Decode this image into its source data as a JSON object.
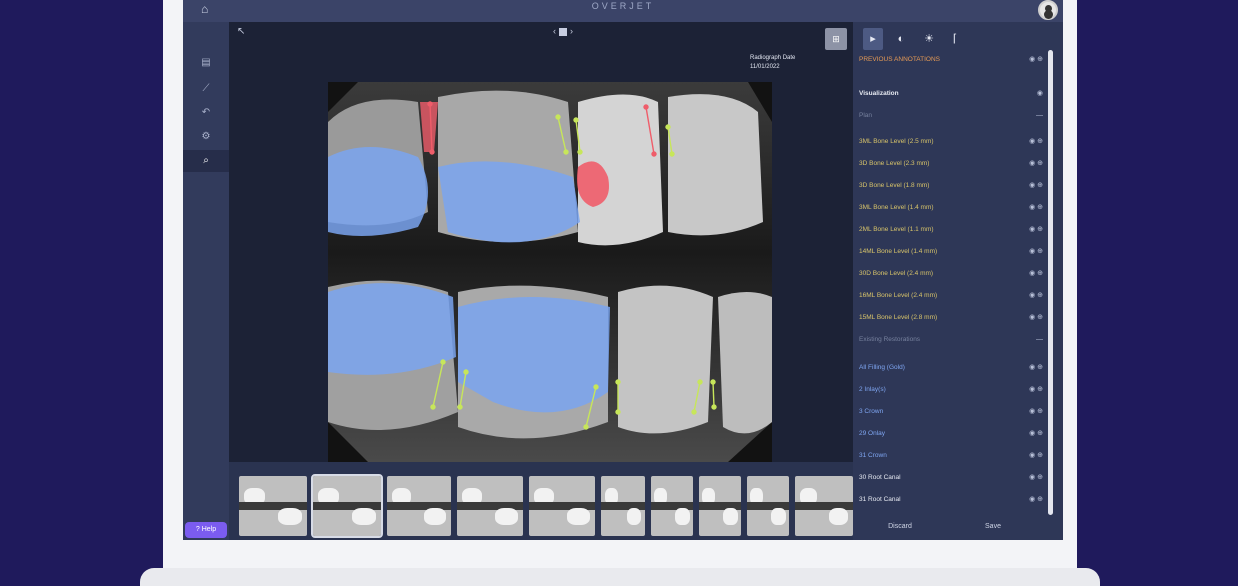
{
  "app": {
    "brand": "OVERJET"
  },
  "left_rail": {
    "items": [
      {
        "icon": "folder-icon",
        "glyph": "▤"
      },
      {
        "icon": "ruler-icon",
        "glyph": "⟋"
      },
      {
        "icon": "undo-icon",
        "glyph": "↶"
      },
      {
        "icon": "settings-icon",
        "glyph": "⚙"
      },
      {
        "icon": "search-icon",
        "glyph": "⌕"
      }
    ],
    "help_label": "Help"
  },
  "viewer": {
    "back_glyph": "↖",
    "pager": {
      "prev": "‹",
      "next": "›"
    },
    "grid_glyph": "⊞",
    "radiograph_date": {
      "label": "Radiograph Date",
      "value": "11/01/2022"
    }
  },
  "thumbnails": {
    "count": 10,
    "selected_index": 1
  },
  "panel": {
    "tools": [
      {
        "icon": "pointer-icon",
        "glyph": "▸",
        "active": true
      },
      {
        "icon": "tooth-icon",
        "glyph": "◐",
        "active": false
      },
      {
        "icon": "brightness-icon",
        "glyph": "☀",
        "active": false
      },
      {
        "icon": "measure-icon",
        "glyph": "⌈",
        "active": false
      }
    ],
    "rows": [
      {
        "text": "PREVIOUS ANNOTATIONS",
        "style": "orange",
        "ctrl": "◉ ⊕"
      },
      {
        "text": "Visualization",
        "style": "head",
        "ctrl": "◉"
      },
      {
        "text": "Plan",
        "style": "muted",
        "ctrl": "—"
      },
      {
        "text": "3ML Bone Level (2.5 mm)",
        "style": "yellow",
        "ctrl": "◉ ⊕"
      },
      {
        "text": "3D Bone Level (2.3 mm)",
        "style": "yellow",
        "ctrl": "◉ ⊕"
      },
      {
        "text": "3D Bone Level (1.8 mm)",
        "style": "yellow",
        "ctrl": "◉ ⊕"
      },
      {
        "text": "3ML Bone Level (1.4 mm)",
        "style": "yellow",
        "ctrl": "◉ ⊕"
      },
      {
        "text": "2ML Bone Level (1.1 mm)",
        "style": "yellow",
        "ctrl": "◉ ⊕"
      },
      {
        "text": "14ML Bone Level (1.4 mm)",
        "style": "yellow",
        "ctrl": "◉ ⊕"
      },
      {
        "text": "30D Bone Level (2.4 mm)",
        "style": "yellow",
        "ctrl": "◉ ⊕"
      },
      {
        "text": "16ML Bone Level (2.4 mm)",
        "style": "yellow",
        "ctrl": "◉ ⊕"
      },
      {
        "text": "15ML Bone Level (2.8 mm)",
        "style": "yellow",
        "ctrl": "◉ ⊕"
      },
      {
        "text": "Existing Restorations",
        "style": "muted",
        "ctrl": "—"
      },
      {
        "text": "All Filling (Gold)",
        "style": "blue",
        "ctrl": "◉ ⊕"
      },
      {
        "text": "2 Inlay(s)",
        "style": "blue",
        "ctrl": "◉ ⊕"
      },
      {
        "text": "3 Crown",
        "style": "blue",
        "ctrl": "◉ ⊕"
      },
      {
        "text": "29 Onlay",
        "style": "blue",
        "ctrl": "◉ ⊕"
      },
      {
        "text": "31 Crown",
        "style": "blue",
        "ctrl": "◉ ⊕"
      },
      {
        "text": "30 Root Canal",
        "style": "white",
        "ctrl": "◉ ⊕"
      },
      {
        "text": "31 Root Canal",
        "style": "white",
        "ctrl": "◉ ⊕"
      }
    ],
    "discard_label": "Discard",
    "save_label": "Save"
  },
  "colors": {
    "background": "#1f1a5c",
    "help_button": "#7b5cf0",
    "restoration_overlay": "#7aa4f0",
    "decay_overlay": "#ef5d6a",
    "bone_marker": "#c7e65a"
  }
}
